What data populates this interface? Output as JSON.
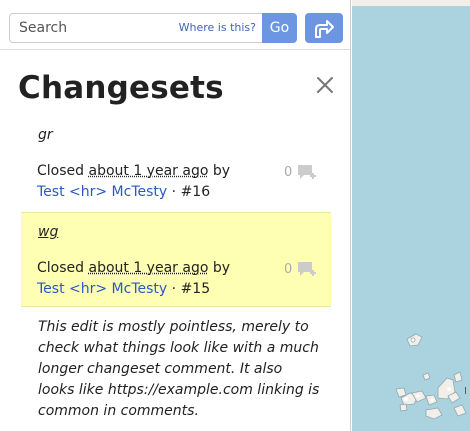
{
  "search": {
    "placeholder": "Search",
    "where_link": "Where is this?",
    "go_label": "Go"
  },
  "panel": {
    "title": "Changesets"
  },
  "changesets": [
    {
      "comment": "gr",
      "status": "Closed",
      "time": "about 1 year ago",
      "by": "by",
      "user": "Test <hr> McTesty",
      "separator": "·",
      "id": "#16",
      "comment_count": "0"
    },
    {
      "comment": "wg",
      "status": "Closed",
      "time": "about 1 year ago",
      "by": "by",
      "user": "Test <hr> McTesty",
      "separator": "·",
      "id": "#15",
      "comment_count": "0"
    },
    {
      "comment": "This edit is mostly pointless, merely to check what things look like with a much longer changeset comment. It also looks like https://example.com linking is common in comments."
    }
  ],
  "map": {
    "label": "I"
  },
  "colors": {
    "accent": "#6d96e2",
    "link": "#2a58c8",
    "highlight": "#ffffb3",
    "water": "#aad3df"
  }
}
